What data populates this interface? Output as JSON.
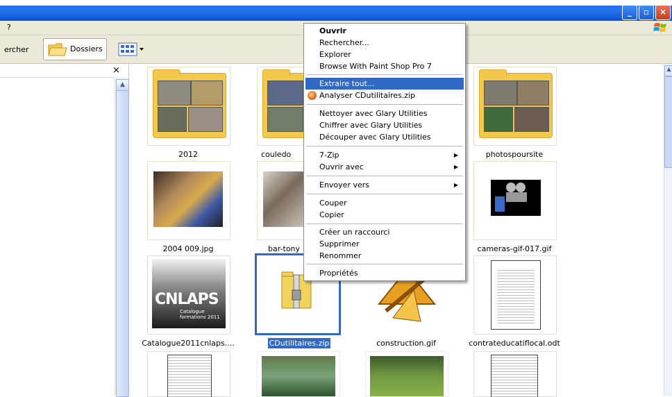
{
  "window": {
    "title_fragment": ")",
    "buttons": [
      "_",
      "□",
      "X"
    ]
  },
  "menubar": {
    "help": "?"
  },
  "toolbar": {
    "search_label": "ercher",
    "folders_label": "Dossiers"
  },
  "leftpane": {
    "close_glyph": "×"
  },
  "items": [
    {
      "name": "2012",
      "kind": "folder"
    },
    {
      "name": "couledo",
      "kind": "folder"
    },
    {
      "name": "photospoursite",
      "kind": "folder"
    },
    {
      "name": "2004 009.jpg",
      "kind": "image"
    },
    {
      "name": "bar-tony",
      "kind": "image"
    },
    {
      "name": "cameras-gif-017.gif",
      "kind": "gif"
    },
    {
      "name": "Catalogue2011cnlaps....",
      "kind": "image",
      "thumb_text": {
        "big": "CNLAPS",
        "small1": "Catalogue",
        "small2": "formations 2011"
      }
    },
    {
      "name": "CDutilitaires.zip",
      "kind": "zip",
      "selected": true
    },
    {
      "name": "construction.gif",
      "kind": "gif"
    },
    {
      "name": "contrateducatiflocal.odt",
      "kind": "document"
    }
  ],
  "context_menu": {
    "items": [
      {
        "label": "Ouvrir",
        "bold": true
      },
      {
        "label": "Rechercher..."
      },
      {
        "label": "Explorer"
      },
      {
        "label": "Browse With Paint Shop Pro 7"
      },
      {
        "label": "Extraire tout...",
        "highlighted": true
      },
      {
        "label": "Analyser CDutilitaires.zip",
        "icon": "avast-icon"
      },
      {
        "label": "Nettoyer avec Glary Utilities"
      },
      {
        "label": "Chiffrer avec Glary Utilities"
      },
      {
        "label": "Découper avec Glary Utilities"
      },
      {
        "label": "7-Zip",
        "submenu": true
      },
      {
        "label": "Ouvrir avec",
        "submenu": true
      },
      {
        "label": "Envoyer vers",
        "submenu": true
      },
      {
        "label": "Couper"
      },
      {
        "label": "Copier"
      },
      {
        "label": "Créer un raccourci"
      },
      {
        "label": "Supprimer"
      },
      {
        "label": "Renommer"
      },
      {
        "label": "Propriétés"
      }
    ]
  },
  "colors": {
    "titlebar": "#2a77f0",
    "selection": "#316ac5",
    "menubar": "#ece9d8"
  }
}
